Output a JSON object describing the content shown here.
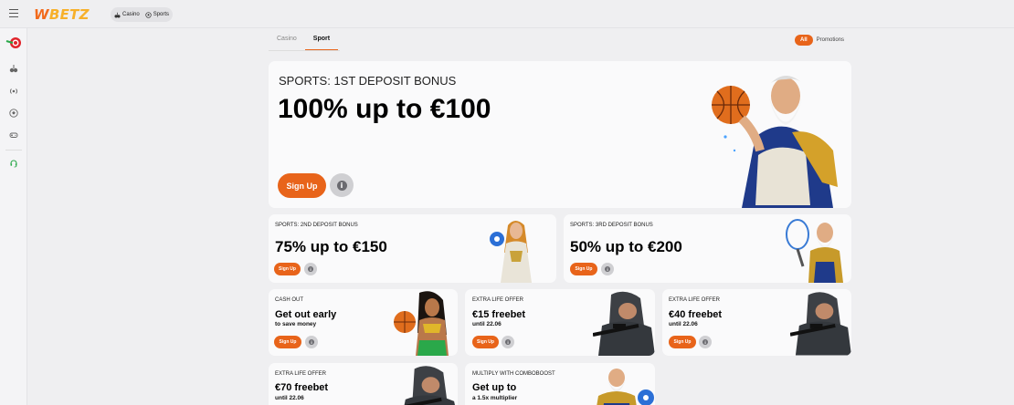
{
  "brand": {
    "logo_w": "W",
    "logo_rest": "BETZ"
  },
  "topnav": {
    "casino": "Casino",
    "sports": "Sports"
  },
  "tabs": [
    {
      "label": "Casino"
    },
    {
      "label": "Sport"
    }
  ],
  "filters": {
    "all": "All",
    "promotions": "Promotions"
  },
  "cards": [
    {
      "kicker": "SPORTS: 1ST DEPOSIT BONUS",
      "headline": "100% up to €100",
      "button": "Sign Up"
    },
    {
      "kicker": "SPORTS: 2ND DEPOSIT BONUS",
      "headline": "75% up to €150",
      "button": "Sign Up"
    },
    {
      "kicker": "SPORTS: 3RD DEPOSIT BONUS",
      "headline": "50% up to €200",
      "button": "Sign Up"
    },
    {
      "kicker": "CASH OUT",
      "headline": "Get out early",
      "sub": "to save money",
      "button": "Sign Up"
    },
    {
      "kicker": "EXTRA LIFE OFFER",
      "headline": "€15 freebet",
      "sub": "until 22.06",
      "button": "Sign Up"
    },
    {
      "kicker": "EXTRA LIFE OFFER",
      "headline": "€40 freebet",
      "sub": "until 22.06",
      "button": "Sign Up"
    },
    {
      "kicker": "EXTRA LIFE OFFER",
      "headline": "€70 freebet",
      "sub": "until 22.06"
    },
    {
      "kicker": "MULTIPLY WITH COMBOBOOST",
      "headline": "Get up to",
      "sub": "a 1.5x multiplier"
    }
  ],
  "colors": {
    "accent": "#e8641a",
    "logo_w": "#f26b1d",
    "logo_rest": "#f7b02a",
    "support": "#2aa84a"
  },
  "icons": [
    "menu-icon",
    "casino-icon",
    "sports-icon",
    "roulette-icon",
    "live-icon",
    "football-icon",
    "gamepad-icon",
    "support-icon",
    "info-icon"
  ]
}
